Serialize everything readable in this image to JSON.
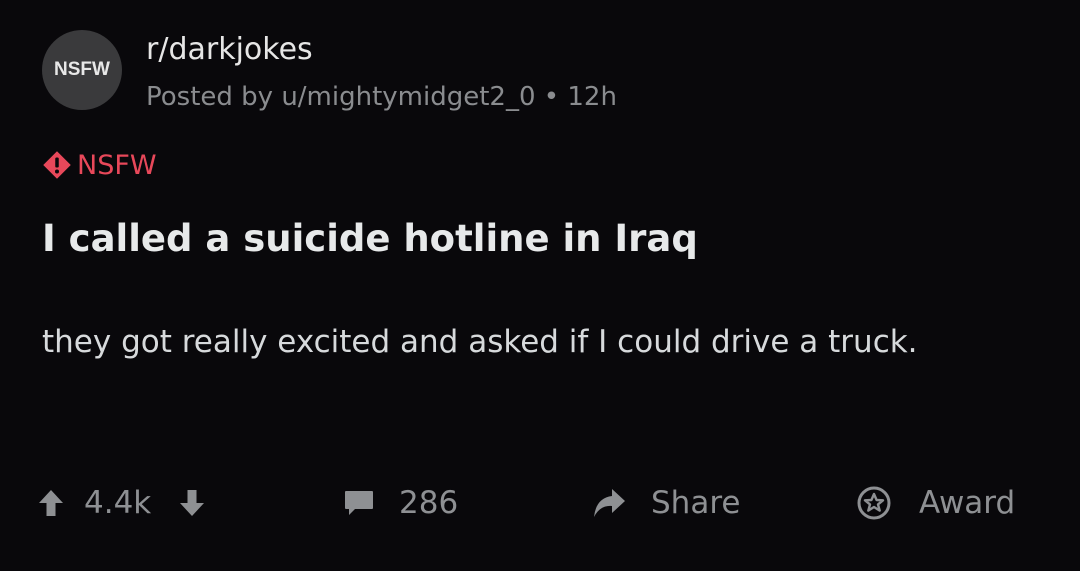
{
  "post": {
    "avatar_label": "NSFW",
    "subreddit": "r/darkjokes",
    "meta": "Posted by u/mightymidget2_0 • 12h",
    "nsfw_label": "NSFW",
    "title": "I called a suicide hotline in Iraq",
    "body": "they got really excited and asked if I could drive a truck."
  },
  "actions": {
    "score": "4.4k",
    "comments": "286",
    "share_label": "Share",
    "award_label": "Award"
  },
  "icons": {
    "upvote": "arrow-up-icon",
    "downvote": "arrow-down-icon",
    "comment": "speech-bubble-icon",
    "share": "share-arrow-icon",
    "award": "star-icon",
    "nsfw": "warning-icon"
  },
  "colors": {
    "background": "#09080b",
    "nsfw_accent": "#e8485a",
    "muted": "#8e9093"
  }
}
